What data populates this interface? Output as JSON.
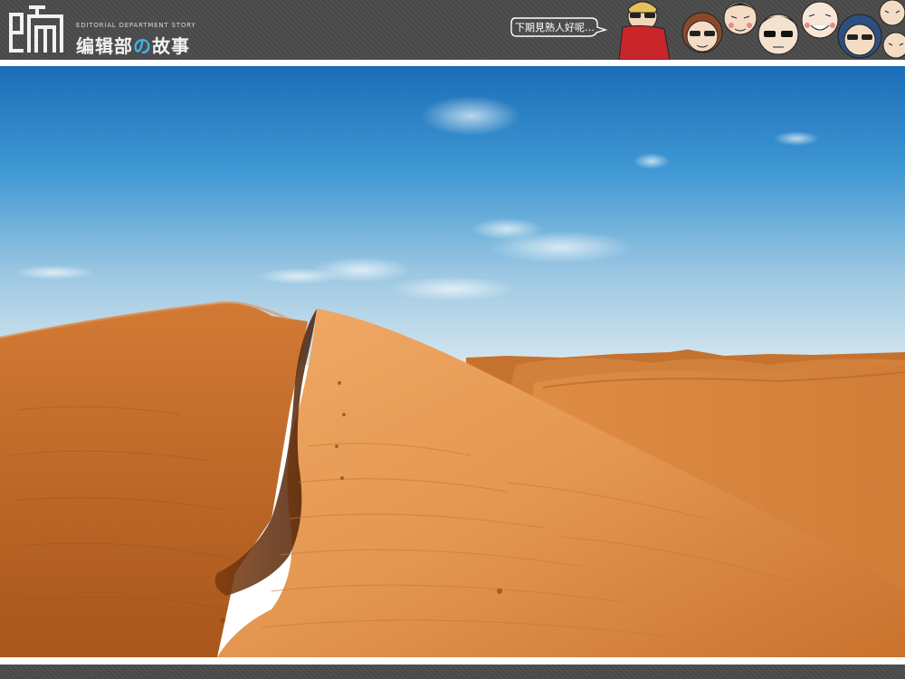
{
  "header": {
    "logo_glyph_text": "编",
    "tagline": "EDITORIAL DEPARTMENT STORY",
    "title_part1": "编辑部",
    "title_no": "の",
    "title_part2": "故事",
    "speech_bubble": "下期見熟人好呢…"
  },
  "colors": {
    "header_bg": "#4a4a4a",
    "accent_blue": "#3fb3e6",
    "sky_top": "#1f6fb8",
    "sky_bottom": "#cfe3ee",
    "sand_light": "#e9a15c",
    "sand_dark": "#b35a1e"
  },
  "icons": {
    "logo": "editorial-logo-icon",
    "faces": "character-faces-illustration",
    "photo": "desert-dunes-photo"
  }
}
